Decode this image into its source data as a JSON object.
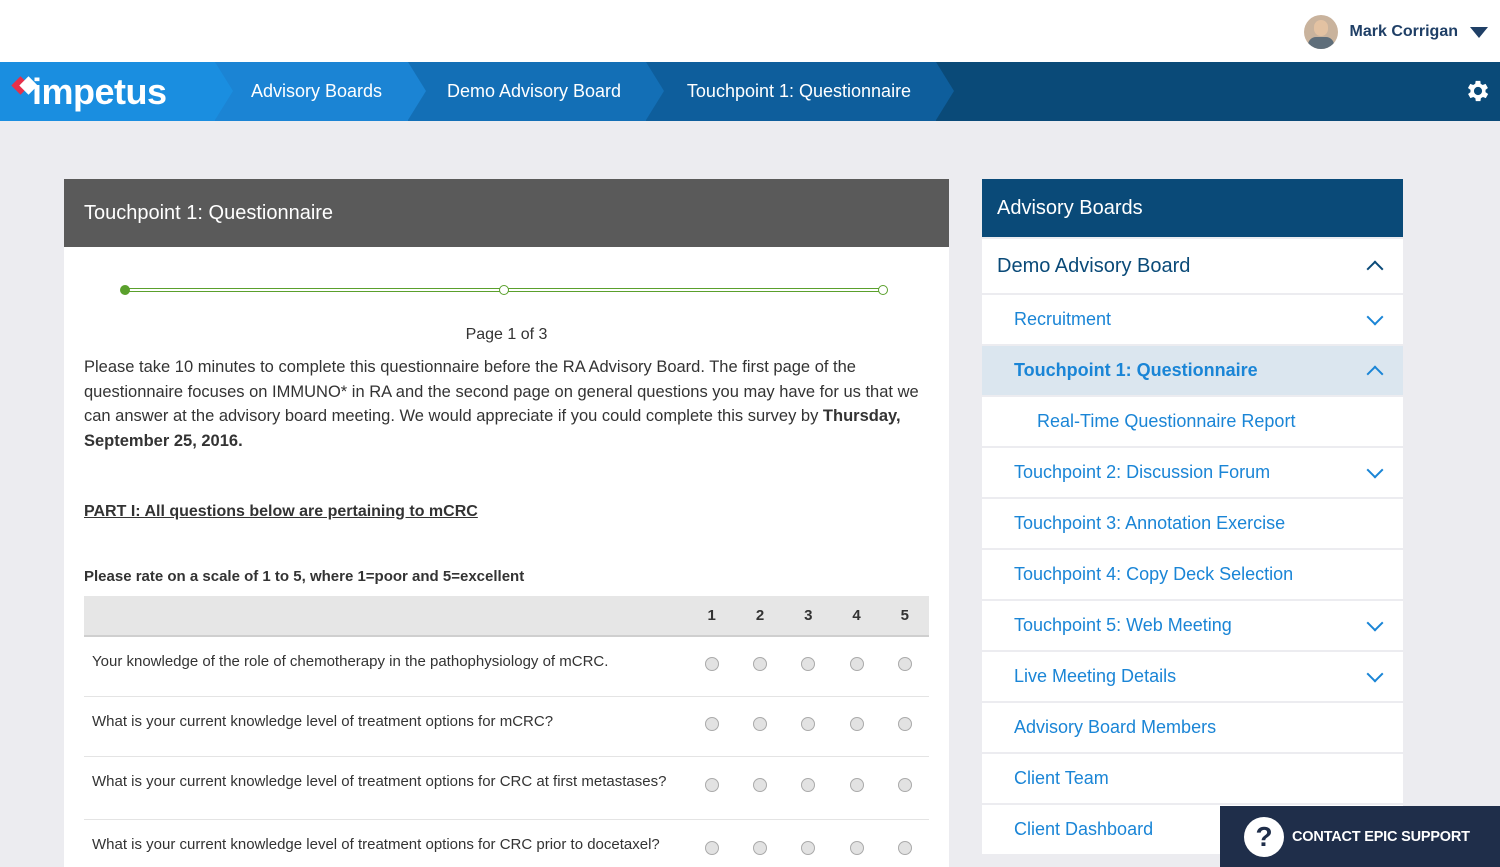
{
  "user": {
    "name": "Mark Corrigan"
  },
  "nav": {
    "logo": "impetus",
    "breadcrumbs": [
      "Advisory Boards",
      "Demo Advisory Board",
      "Touchpoint 1: Questionnaire"
    ]
  },
  "main": {
    "title": "Touchpoint 1: Questionnaire",
    "progress": {
      "current_page": 1,
      "total_pages": 3
    },
    "page_label": "Page 1 of 3",
    "intro_text": "Please take 10 minutes to complete this questionnaire before the RA Advisory Board.  The first page of the questionnaire focuses on IMMUNO* in RA and the second page on general questions you may have for us that we can answer at the advisory board meeting. We would appreciate if you could complete this survey by ",
    "intro_bold": "Thursday, September 25, 2016.",
    "part_heading": "PART I: All questions below are pertaining to mCRC",
    "instruction": "Please rate on a scale of 1 to 5, where 1=poor and 5=excellent",
    "scale": [
      "1",
      "2",
      "3",
      "4",
      "5"
    ],
    "questions": [
      "Your knowledge of the role of chemotherapy in the pathophysiology of mCRC.",
      "What is your current knowledge level of treatment options for mCRC?",
      "What is your current knowledge level of treatment options for CRC at first metastases?",
      "What is your current knowledge level of treatment options for CRC prior to docetaxel?"
    ]
  },
  "sidebar": {
    "title": "Advisory Boards",
    "board": "Demo Advisory Board",
    "items": [
      {
        "label": "Recruitment"
      },
      {
        "label": "Touchpoint 1: Questionnaire"
      },
      {
        "label": "Real-Time Questionnaire Report"
      },
      {
        "label": "Touchpoint 2: Discussion Forum"
      },
      {
        "label": "Touchpoint 3: Annotation Exercise"
      },
      {
        "label": "Touchpoint 4: Copy Deck Selection"
      },
      {
        "label": "Touchpoint 5: Web Meeting"
      },
      {
        "label": "Live Meeting Details"
      },
      {
        "label": "Advisory Board Members"
      },
      {
        "label": "Client Team"
      },
      {
        "label": "Client Dashboard"
      }
    ]
  },
  "support": {
    "label": "CONTACT EPIC SUPPORT",
    "icon": "question-icon"
  },
  "colors": {
    "navy": "#0a4a78",
    "accent_blue": "#1a85d6",
    "progress_green": "#5aa02c",
    "header_gray": "#5a5a5a"
  }
}
